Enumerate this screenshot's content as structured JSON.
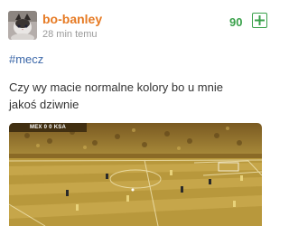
{
  "post": {
    "author": "bo-banley",
    "time": "28 min temu",
    "votes": "90",
    "tag": "#mecz",
    "text": "Czy wy macie normalne kolory bo u mnie jakoś dziwnie"
  },
  "scoreboard": {
    "home": "MEX",
    "home_score": "0",
    "away_score": "0",
    "away": "KSA"
  },
  "icons": {
    "plus": "plus-icon",
    "avatar": "cat-avatar"
  },
  "colors": {
    "author": "#e67a23",
    "votes": "#3aa14b",
    "tag": "#3b67a8",
    "pitch_tint": "#c9a64a"
  }
}
